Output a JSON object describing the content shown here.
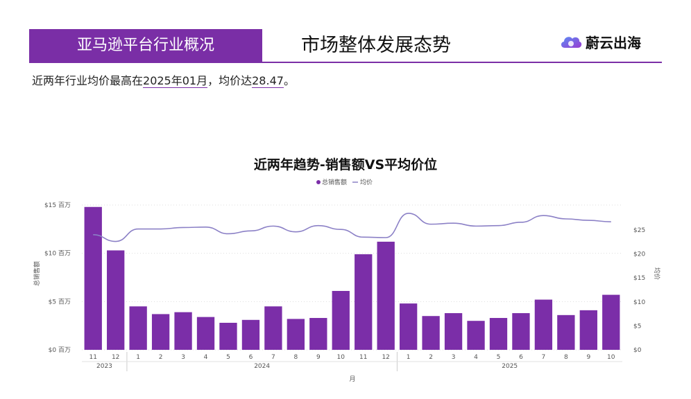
{
  "header": {
    "section_title": "亚马逊平台行业概况",
    "page_title": "市场整体发展态势",
    "brand_name": "蔚云出海"
  },
  "insight": {
    "prefix": "近两年行业均价最高在",
    "month": "2025年01月",
    "middle": "，均价达",
    "value": "28.47",
    "suffix": "。"
  },
  "colors": {
    "accent": "#7a2ea6",
    "bar": "#7b2ea8",
    "line": "#8b80c6"
  },
  "chart_data": {
    "type": "bar+line",
    "title": "近两年趋势-销售额VS平均价位",
    "legend": [
      "总销售额",
      "均价"
    ],
    "legend_position": "top-center",
    "xlabel": "月",
    "ylabel_left": "总销售额",
    "ylabel_right": "均价",
    "categories": [
      "11",
      "12",
      "1",
      "2",
      "3",
      "4",
      "5",
      "6",
      "7",
      "8",
      "9",
      "10",
      "11",
      "12",
      "1",
      "2",
      "3",
      "4",
      "5",
      "6",
      "7",
      "8",
      "9",
      "10"
    ],
    "year_groups": [
      {
        "label": "2023",
        "count": 2
      },
      {
        "label": "2024",
        "count": 12
      },
      {
        "label": "2025",
        "count": 10
      }
    ],
    "series": [
      {
        "name": "总销售额",
        "type": "bar",
        "unit": "百万",
        "values": [
          14.8,
          10.3,
          4.5,
          3.7,
          3.9,
          3.4,
          2.8,
          3.1,
          4.5,
          3.2,
          3.3,
          6.1,
          9.9,
          11.2,
          4.8,
          3.5,
          3.8,
          3.0,
          3.3,
          3.8,
          5.2,
          3.6,
          4.1,
          5.7
        ]
      },
      {
        "name": "均价",
        "type": "line",
        "values": [
          24.0,
          22.6,
          25.2,
          25.2,
          25.5,
          25.6,
          24.2,
          24.8,
          25.8,
          24.6,
          25.9,
          25.1,
          23.5,
          23.4,
          28.47,
          26.2,
          26.4,
          25.8,
          25.9,
          26.6,
          28.0,
          27.3,
          27.0,
          26.7
        ]
      }
    ],
    "y_left": {
      "ticks": [
        "$0 百万",
        "$5 百万",
        "$10 百万",
        "$15 百万"
      ],
      "tick_values": [
        0,
        5,
        10,
        15
      ],
      "range": [
        0,
        15.5
      ]
    },
    "y_right": {
      "ticks": [
        "$0",
        "$5",
        "$10",
        "$15",
        "$20",
        "$25"
      ],
      "tick_values": [
        0,
        5,
        10,
        15,
        20,
        25
      ],
      "range": [
        0,
        31.2
      ]
    },
    "grid": true
  }
}
